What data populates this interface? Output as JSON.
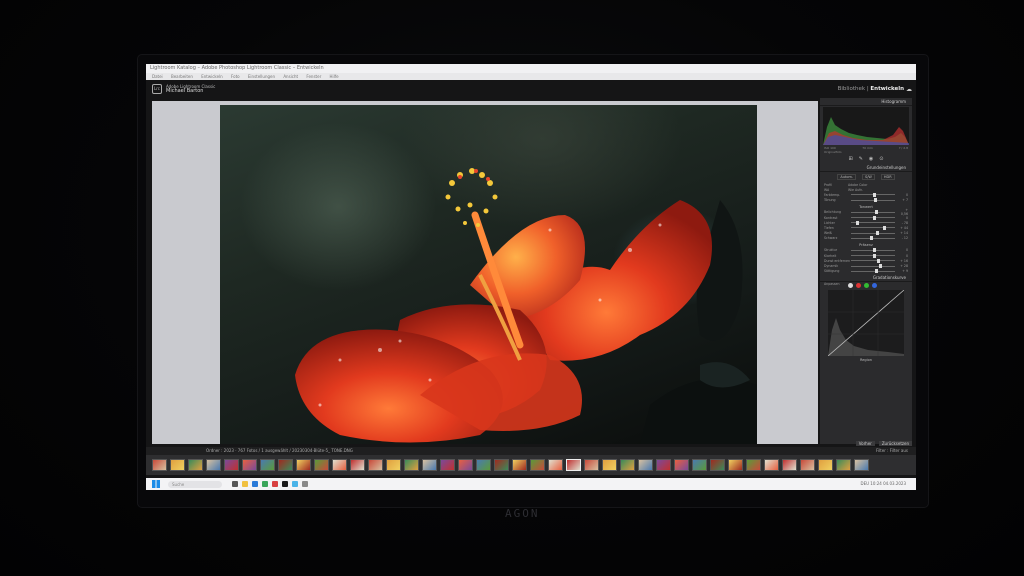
{
  "window": {
    "title": "Lightroom Katalog – Adobe Photoshop Lightroom Classic – Entwickeln",
    "menu": [
      "Datei",
      "Bearbeiten",
      "Entwickeln",
      "Foto",
      "Einstellungen",
      "Ansicht",
      "Fenster",
      "Hilfe"
    ]
  },
  "identity": {
    "logo": "Lrc",
    "top": "Adobe Lightroom Classic",
    "name": "Michael Barton"
  },
  "modules": {
    "library": "Bibliothek",
    "separator": "|",
    "develop": "Entwickeln"
  },
  "panel": {
    "histogram_title": "Histogramm",
    "histo_left": "ISO 100",
    "histo_mid": "70 mm",
    "histo_right": "f / 2.8",
    "original_photo": "Originalfoto",
    "basic_title": "Grundeinstellungen",
    "treatment": [
      "Autom.",
      "S/W",
      "HDR"
    ],
    "profile_label": "Profil",
    "profile_value": "Adobe Color",
    "wb_label": "WA",
    "wb_value": "Wie Aufn.",
    "tone_header": "Tonwert",
    "presence_header": "Präsenz",
    "curve_title": "Gradationskurve",
    "curve_adjust": "Anpassen",
    "sliders_top": [
      {
        "label": "Farbtemp.",
        "value": "0"
      },
      {
        "label": "Tönung",
        "value": "+ 7"
      }
    ],
    "sliders_tone": [
      {
        "label": "Belichtung",
        "value": "+ 0,56"
      },
      {
        "label": "Kontrast",
        "value": "0"
      },
      {
        "label": "Lichter",
        "value": "- 78"
      },
      {
        "label": "Tiefen",
        "value": "+ 44"
      },
      {
        "label": "Weiß",
        "value": "+ 14"
      },
      {
        "label": "Schwarz",
        "value": "- 12"
      }
    ],
    "sliders_presence": [
      {
        "label": "Struktur",
        "value": "0"
      },
      {
        "label": "Klarheit",
        "value": "0"
      },
      {
        "label": "Dunst entfernen",
        "value": "+ 16"
      },
      {
        "label": "Dynamik",
        "value": "+ 28"
      },
      {
        "label": "Sättigung",
        "value": "+ 9"
      }
    ],
    "region": "Region",
    "prev_button": "Vorher",
    "reset_button": "Zurücksetzen"
  },
  "filmstrip": {
    "info": "Ordner : 2023 · 767 Fotos / 1 ausgewählt / 20230304-Blüte-5_ TONE.DNG",
    "filter_label": "Filter :",
    "filter_value": "Filter aus"
  },
  "taskbar": {
    "search_placeholder": "Suche",
    "tray": "DEU  10:24  04.03.2023"
  },
  "monitor_brand": "AGON",
  "colors": {
    "accent": "#1c8ce8",
    "panel": "#2b2b2d",
    "viewer_bg": "#c9cacf"
  }
}
